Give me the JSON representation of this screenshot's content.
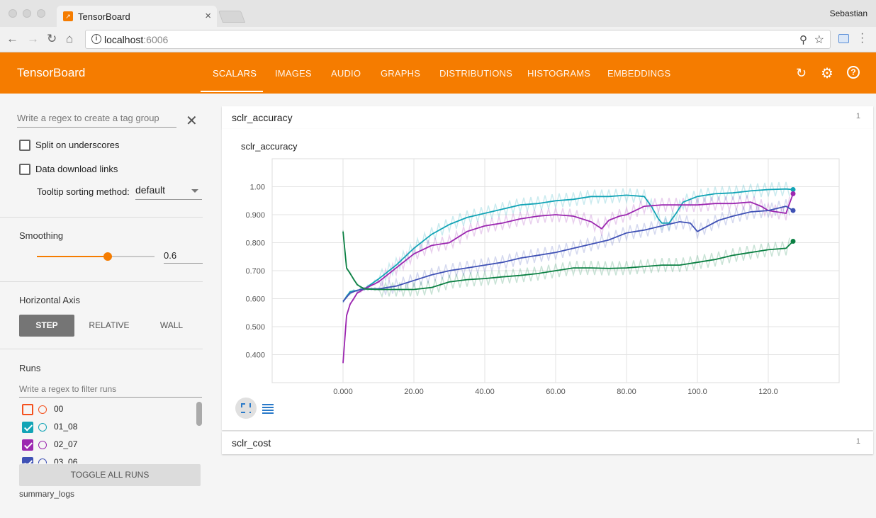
{
  "browser": {
    "tab_title": "TensorBoard",
    "url_host": "localhost",
    "url_port": ":6006",
    "profile_name": "Sebastian"
  },
  "app": {
    "title": "TensorBoard",
    "nav_tabs": [
      "SCALARS",
      "IMAGES",
      "AUDIO",
      "GRAPHS",
      "DISTRIBUTIONS",
      "HISTOGRAMS",
      "EMBEDDINGS"
    ],
    "active_tab": "SCALARS",
    "icons": [
      "refresh-icon",
      "settings-icon",
      "help-icon"
    ]
  },
  "sidebar": {
    "tag_filter_placeholder": "Write a regex to create a tag group",
    "split_label": "Split on underscores",
    "split_checked": false,
    "download_label": "Data download links",
    "download_checked": false,
    "tooltip_label": "Tooltip sorting method:",
    "tooltip_value": "default",
    "smoothing_heading": "Smoothing",
    "smoothing_value": "0.6",
    "smoothing_fraction": 0.6,
    "axis_heading": "Horizontal Axis",
    "axis_options": [
      "STEP",
      "RELATIVE",
      "WALL"
    ],
    "axis_selected": "STEP",
    "runs_heading": "Runs",
    "runs_filter_placeholder": "Write a regex to filter runs",
    "runs": [
      {
        "name": "00",
        "checked": false,
        "color": "#f4511e"
      },
      {
        "name": "01_08",
        "checked": true,
        "color": "#12a4b6"
      },
      {
        "name": "02_07",
        "checked": true,
        "color": "#9c27b0"
      },
      {
        "name": "03_06",
        "checked": true,
        "color": "#3f51b5"
      }
    ],
    "toggle_all_label": "TOGGLE ALL RUNS",
    "log_dir": "summary_logs"
  },
  "main": {
    "card1_title": "sclr_accuracy",
    "card1_count": "1",
    "chart_title": "sclr_accuracy",
    "card2_title": "sclr_cost",
    "card2_count": "1"
  },
  "chart_data": {
    "type": "line",
    "title": "sclr_accuracy",
    "xlabel": "",
    "ylabel": "",
    "x_ticks": [
      "0.000",
      "20.00",
      "40.00",
      "60.00",
      "80.00",
      "100.0",
      "120.0"
    ],
    "y_ticks": [
      "0.400",
      "0.500",
      "0.600",
      "0.700",
      "0.800",
      "0.900",
      "1.00"
    ],
    "xlim": [
      -20,
      140
    ],
    "ylim": [
      0.3,
      1.1
    ],
    "grid": true,
    "series": [
      {
        "color": "#12a4b6",
        "x": [
          0,
          2,
          4,
          6,
          10,
          15,
          20,
          25,
          30,
          35,
          40,
          45,
          50,
          55,
          60,
          65,
          70,
          75,
          80,
          85,
          87,
          89,
          90,
          92,
          94,
          96,
          100,
          105,
          110,
          115,
          120,
          125,
          127
        ],
        "y": [
          0.59,
          0.625,
          0.63,
          0.635,
          0.67,
          0.72,
          0.78,
          0.83,
          0.865,
          0.89,
          0.905,
          0.92,
          0.935,
          0.94,
          0.95,
          0.955,
          0.965,
          0.965,
          0.97,
          0.965,
          0.93,
          0.885,
          0.87,
          0.87,
          0.905,
          0.945,
          0.965,
          0.975,
          0.978,
          0.985,
          0.99,
          0.992,
          0.99
        ]
      },
      {
        "color": "#9c27b0",
        "x": [
          0,
          1,
          2,
          4,
          6,
          10,
          15,
          20,
          25,
          30,
          35,
          40,
          45,
          50,
          55,
          60,
          65,
          70,
          73,
          75,
          78,
          80,
          85,
          90,
          95,
          100,
          105,
          110,
          115,
          118,
          120,
          125,
          127
        ],
        "y": [
          0.37,
          0.54,
          0.58,
          0.62,
          0.635,
          0.66,
          0.71,
          0.76,
          0.79,
          0.8,
          0.84,
          0.86,
          0.87,
          0.885,
          0.895,
          0.9,
          0.895,
          0.875,
          0.85,
          0.88,
          0.895,
          0.9,
          0.93,
          0.935,
          0.935,
          0.935,
          0.94,
          0.94,
          0.945,
          0.93,
          0.915,
          0.905,
          0.975
        ]
      },
      {
        "color": "#3f51b5",
        "x": [
          0,
          2,
          4,
          6,
          10,
          15,
          20,
          25,
          30,
          35,
          40,
          45,
          50,
          55,
          60,
          65,
          70,
          75,
          80,
          85,
          90,
          95,
          98,
          100,
          103,
          106,
          110,
          115,
          120,
          125,
          127
        ],
        "y": [
          0.59,
          0.62,
          0.63,
          0.635,
          0.635,
          0.645,
          0.665,
          0.685,
          0.7,
          0.71,
          0.72,
          0.73,
          0.745,
          0.755,
          0.765,
          0.78,
          0.795,
          0.81,
          0.835,
          0.845,
          0.86,
          0.875,
          0.87,
          0.84,
          0.86,
          0.88,
          0.895,
          0.91,
          0.915,
          0.93,
          0.915
        ]
      },
      {
        "color": "#0b8043",
        "x": [
          0,
          1,
          2,
          4,
          6,
          10,
          15,
          20,
          25,
          30,
          35,
          40,
          45,
          50,
          55,
          60,
          65,
          70,
          75,
          80,
          85,
          90,
          95,
          100,
          105,
          110,
          115,
          120,
          125,
          127
        ],
        "y": [
          0.84,
          0.71,
          0.69,
          0.65,
          0.635,
          0.633,
          0.633,
          0.633,
          0.64,
          0.66,
          0.668,
          0.672,
          0.678,
          0.683,
          0.69,
          0.7,
          0.71,
          0.71,
          0.708,
          0.71,
          0.715,
          0.72,
          0.72,
          0.73,
          0.74,
          0.755,
          0.765,
          0.775,
          0.78,
          0.805
        ]
      }
    ]
  }
}
